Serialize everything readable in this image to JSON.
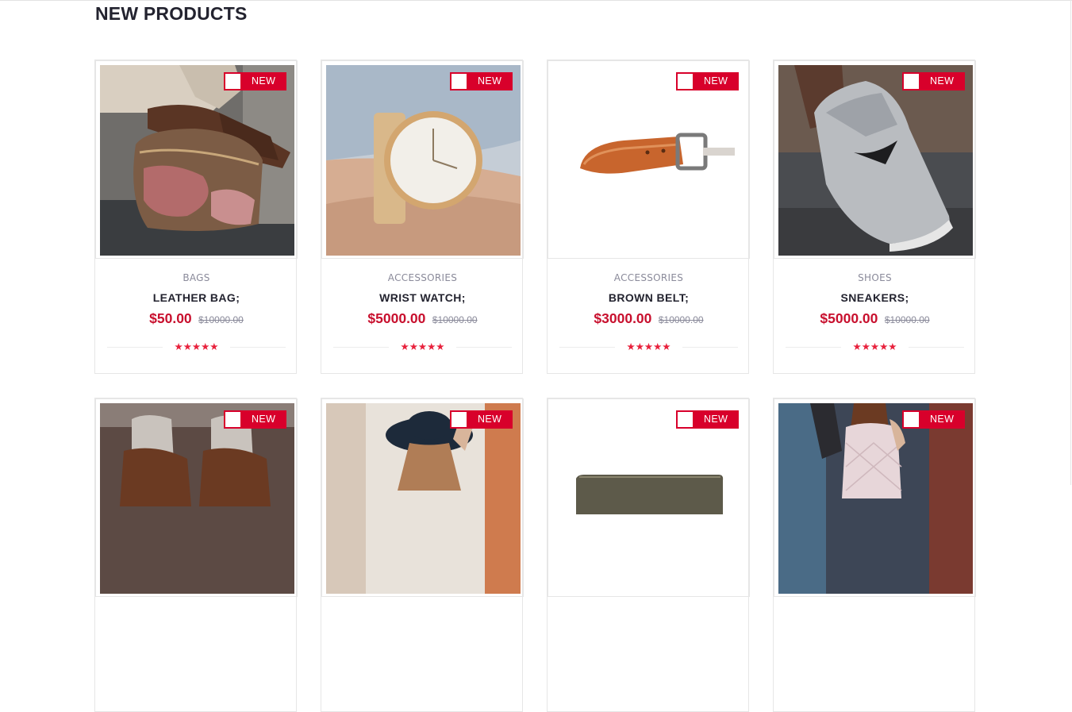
{
  "section": {
    "title": "NEW PRODUCTS"
  },
  "products": [
    {
      "badge": "NEW",
      "category": "BAGS",
      "name": "LEATHER BAG;",
      "price": "$50.00",
      "old_price": "$10000.00",
      "rating": 5,
      "stars": "★★★★★",
      "image_icon": "leather-bag-photo"
    },
    {
      "badge": "NEW",
      "category": "ACCESSORIES",
      "name": "WRIST WATCH;",
      "price": "$5000.00",
      "old_price": "$10000.00",
      "rating": 5,
      "stars": "★★★★★",
      "image_icon": "wrist-watch-photo"
    },
    {
      "badge": "NEW",
      "category": "ACCESSORIES",
      "name": "BROWN BELT;",
      "price": "$3000.00",
      "old_price": "$10000.00",
      "rating": 5,
      "stars": "★★★★★",
      "image_icon": "brown-belt-photo"
    },
    {
      "badge": "NEW",
      "category": "SHOES",
      "name": "SNEAKERS;",
      "price": "$5000.00",
      "old_price": "$10000.00",
      "rating": 5,
      "stars": "★★★★★",
      "image_icon": "sneakers-photo"
    },
    {
      "badge": "NEW",
      "image_icon": "boots-photo"
    },
    {
      "badge": "NEW",
      "image_icon": "woman-hat-photo"
    },
    {
      "badge": "NEW",
      "image_icon": "wallet-photo"
    },
    {
      "badge": "NEW",
      "image_icon": "quilted-bag-photo"
    }
  ],
  "colors": {
    "accent": "#d8002b",
    "price": "#c8102e",
    "star": "#e8213c",
    "title": "#23232f",
    "muted": "#8a8a9a"
  }
}
